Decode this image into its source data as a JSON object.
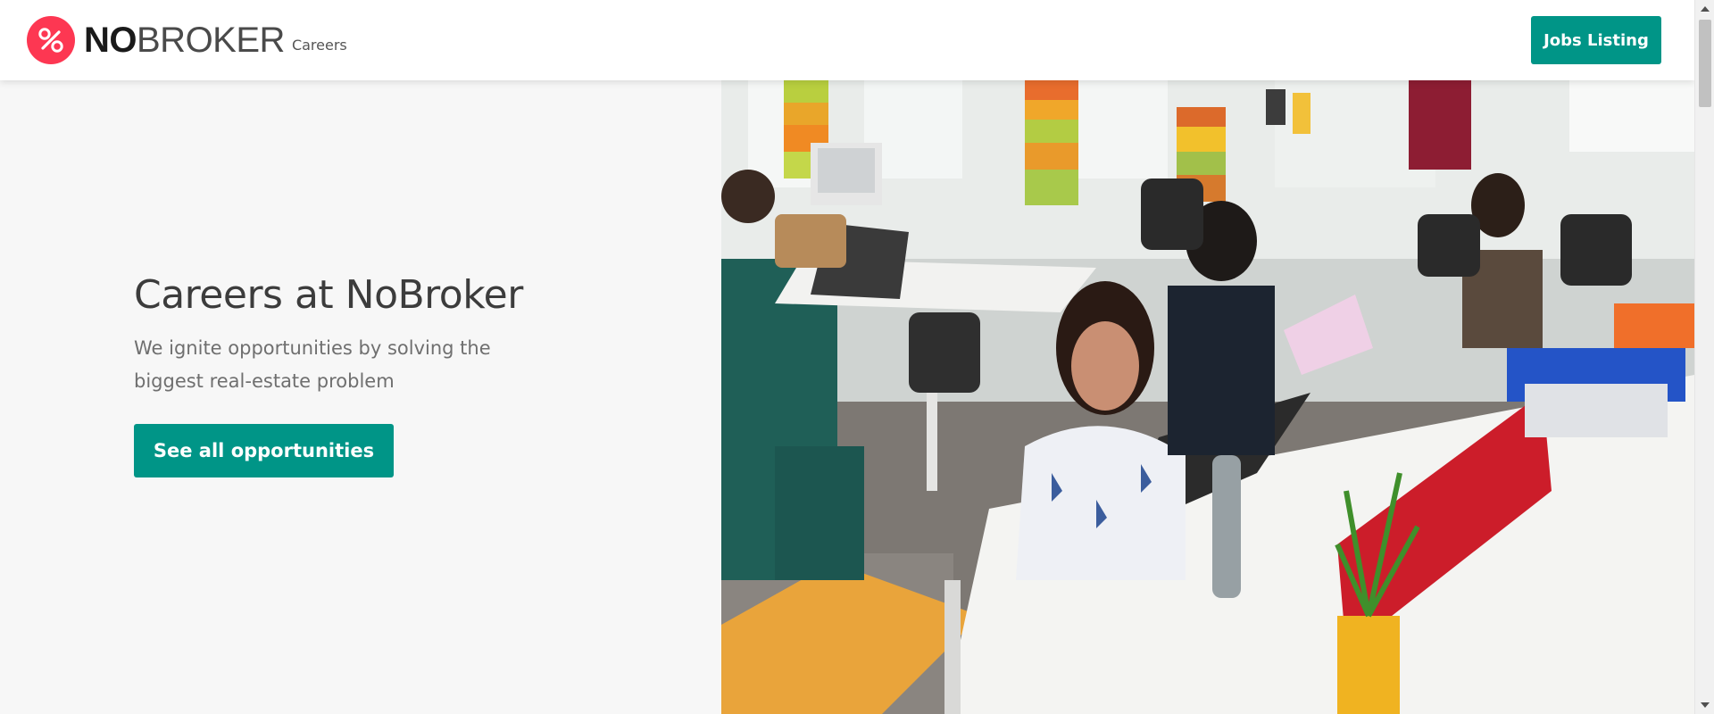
{
  "header": {
    "brand_bold": "NO",
    "brand_light": "BROKER",
    "brand_sub": "Careers",
    "jobs_button_label": "Jobs Listing"
  },
  "hero": {
    "title": "Careers at NoBroker",
    "description": "We ignite opportunities by solving the biggest real-estate problem",
    "cta_label": "See all opportunities",
    "image_alt": "NoBroker office"
  },
  "colors": {
    "accent": "#009587",
    "brand": "#fd3752",
    "background": "#f7f7f7"
  },
  "icons": {
    "logo": "nobroker-logo-icon",
    "scroll_up": "chevron-up-icon",
    "scroll_down": "chevron-down-icon"
  }
}
